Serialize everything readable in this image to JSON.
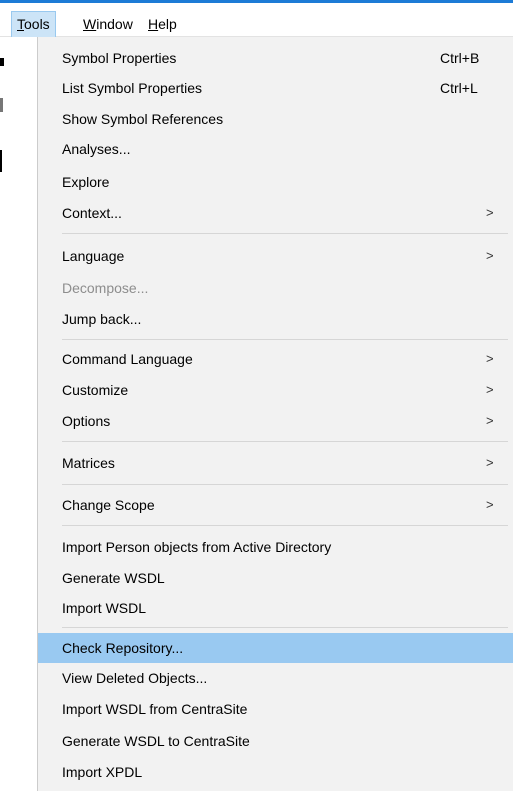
{
  "menubar": {
    "items": [
      {
        "label": "Tools",
        "active": true
      },
      {
        "label": "Window",
        "active": false
      },
      {
        "label": "Help",
        "active": false
      }
    ]
  },
  "menu": {
    "items": [
      {
        "label": "Symbol Properties",
        "shortcut": "Ctrl+B"
      },
      {
        "label": "List Symbol Properties",
        "shortcut": "Ctrl+L"
      },
      {
        "label": "Show Symbol References"
      },
      {
        "label": "Analyses..."
      },
      {
        "label": "Explore"
      },
      {
        "label": "Context...",
        "submenu": true
      },
      {
        "label": "Language",
        "submenu": true
      },
      {
        "label": "Decompose...",
        "disabled": true
      },
      {
        "label": "Jump back..."
      },
      {
        "label": "Command Language",
        "submenu": true
      },
      {
        "label": "Customize",
        "submenu": true
      },
      {
        "label": "Options",
        "submenu": true
      },
      {
        "label": "Matrices",
        "submenu": true
      },
      {
        "label": "Change Scope",
        "submenu": true
      },
      {
        "label": "Import Person objects from Active Directory"
      },
      {
        "label": "Generate WSDL"
      },
      {
        "label": "Import WSDL"
      },
      {
        "label": "Check Repository...",
        "highlighted": true
      },
      {
        "label": "View Deleted Objects..."
      },
      {
        "label": "Import WSDL from CentraSite"
      },
      {
        "label": "Generate WSDL to CentraSite"
      },
      {
        "label": "Import XPDL"
      }
    ],
    "submenu_arrow": ">"
  },
  "colors": {
    "accent": "#1d7bd6",
    "highlight": "#99c9f1",
    "menu_background": "#f2f2f2",
    "disabled_text": "#8d8d8d"
  }
}
